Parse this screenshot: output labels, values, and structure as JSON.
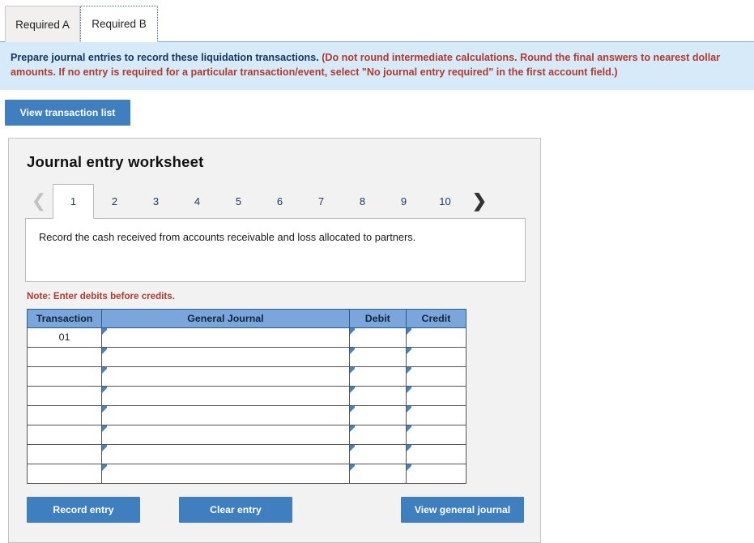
{
  "tabs": [
    {
      "label": "Required A",
      "active": false
    },
    {
      "label": "Required B",
      "active": true
    }
  ],
  "instructions": {
    "lead": "Prepare journal entries to record these liquidation transactions.",
    "paren": "(Do not round intermediate calculations. Round the final answers to nearest dollar amounts. If no entry is required for a particular transaction/event, select \"No journal entry required\" in the first account field.)"
  },
  "toolbar": {
    "view_transaction_list_label": "View transaction list"
  },
  "worksheet": {
    "title": "Journal entry worksheet",
    "pager": {
      "prev_icon": "chevron-left-icon",
      "next_icon": "chevron-right-icon",
      "pages": [
        "1",
        "2",
        "3",
        "4",
        "5",
        "6",
        "7",
        "8",
        "9",
        "10"
      ],
      "active_page": "1"
    },
    "description": "Record the cash received from accounts receivable and loss allocated to partners.",
    "note": "Note: Enter debits before credits.",
    "table": {
      "headers": [
        "Transaction",
        "General Journal",
        "Debit",
        "Credit"
      ],
      "rows": [
        {
          "transaction": "01",
          "general_journal": "",
          "debit": "",
          "credit": ""
        },
        {
          "transaction": "",
          "general_journal": "",
          "debit": "",
          "credit": ""
        },
        {
          "transaction": "",
          "general_journal": "",
          "debit": "",
          "credit": ""
        },
        {
          "transaction": "",
          "general_journal": "",
          "debit": "",
          "credit": ""
        },
        {
          "transaction": "",
          "general_journal": "",
          "debit": "",
          "credit": ""
        },
        {
          "transaction": "",
          "general_journal": "",
          "debit": "",
          "credit": ""
        },
        {
          "transaction": "",
          "general_journal": "",
          "debit": "",
          "credit": ""
        },
        {
          "transaction": "",
          "general_journal": "",
          "debit": "",
          "credit": ""
        }
      ]
    },
    "buttons": {
      "record_entry": "Record entry",
      "clear_entry": "Clear entry",
      "view_general_journal": "View general journal"
    }
  },
  "colors": {
    "button_blue": "#3f7fbf",
    "table_header_blue": "#7aa6dc",
    "instruction_panel_blue": "#d7eaf9",
    "note_red": "#b03a2e",
    "panel_gray": "#f2f2f2"
  }
}
